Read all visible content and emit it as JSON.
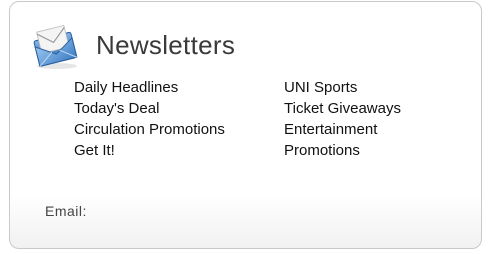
{
  "header": {
    "title": "Newsletters",
    "icon": "envelope-icon",
    "icon_color": "#4a86c8"
  },
  "newsletters": {
    "left": [
      {
        "label": "Daily Headlines"
      },
      {
        "label": "Today's Deal"
      },
      {
        "label": "Circulation Promotions"
      },
      {
        "label": "Get It!"
      }
    ],
    "right": [
      {
        "label": "UNI Sports"
      },
      {
        "label": "Ticket Giveaways"
      },
      {
        "label": "Entertainment"
      },
      {
        "label": "Promotions"
      }
    ]
  },
  "email": {
    "label": "Email:",
    "value": "",
    "placeholder": ""
  },
  "colors": {
    "panel_border": "#c9c9c9",
    "heading_text": "#3a3a3a",
    "link_text": "#111111"
  }
}
